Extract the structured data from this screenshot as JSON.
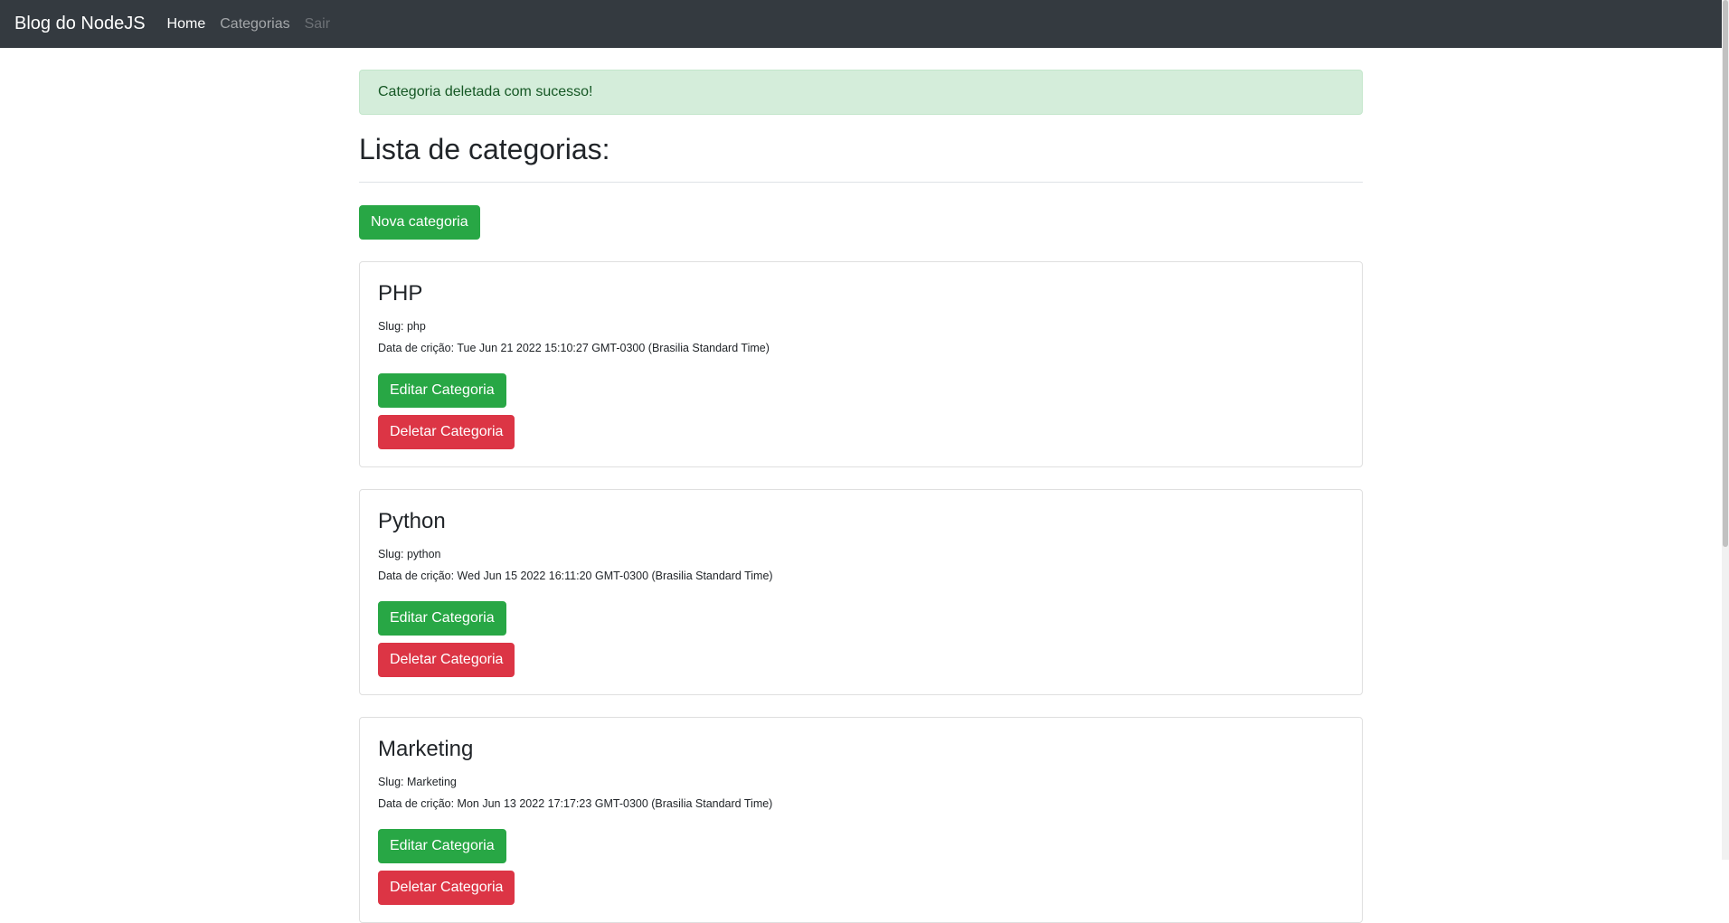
{
  "navbar": {
    "brand": "Blog do NodeJS",
    "links": [
      {
        "label": "Home",
        "state": "active"
      },
      {
        "label": "Categorias",
        "state": "normal"
      },
      {
        "label": "Sair",
        "state": "disabled"
      }
    ]
  },
  "alert": {
    "message": "Categoria deletada com sucesso!"
  },
  "page": {
    "title": "Lista de categorias:",
    "new_button_label": "Nova categoria"
  },
  "categories": [
    {
      "title": "PHP",
      "slug_line": "Slug: php",
      "date_line": "Data de crição: Tue Jun 21 2022 15:10:27 GMT-0300 (Brasilia Standard Time)",
      "edit_label": "Editar Categoria",
      "delete_label": "Deletar Categoria"
    },
    {
      "title": "Python",
      "slug_line": "Slug: python",
      "date_line": "Data de crição: Wed Jun 15 2022 16:11:20 GMT-0300 (Brasilia Standard Time)",
      "edit_label": "Editar Categoria",
      "delete_label": "Deletar Categoria"
    },
    {
      "title": "Marketing",
      "slug_line": "Slug: Marketing",
      "date_line": "Data de crição: Mon Jun 13 2022 17:17:23 GMT-0300 (Brasilia Standard Time)",
      "edit_label": "Editar Categoria",
      "delete_label": "Deletar Categoria"
    }
  ],
  "colors": {
    "navbar_bg": "#343a40",
    "success": "#28a745",
    "danger": "#dc3545",
    "alert_bg": "#d4edda",
    "alert_text": "#155724"
  }
}
